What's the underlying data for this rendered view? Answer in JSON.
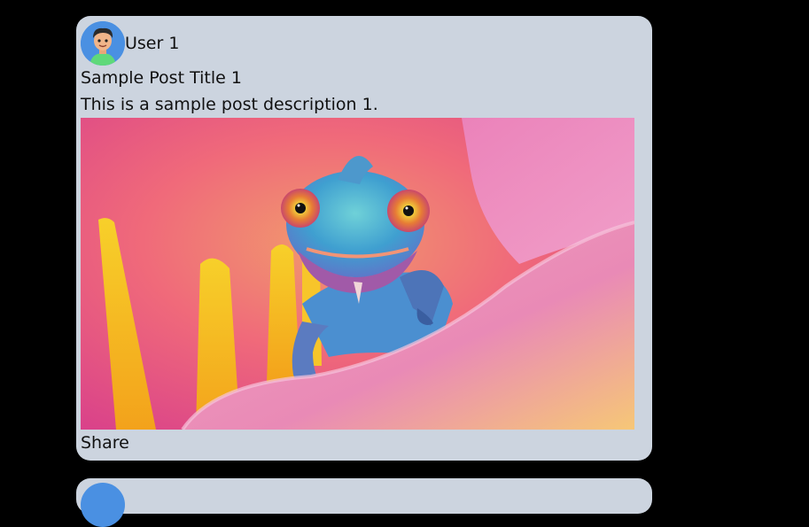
{
  "post": {
    "user_name": "User 1",
    "title": "Sample Post Title 1",
    "description": "This is a sample post description 1.",
    "share_label": "Share",
    "image_subject": "chameleon on pink flower petal"
  },
  "colors": {
    "page_bg": "#000000",
    "card_bg": "#ccd4df",
    "avatar_bg": "#4a90e2"
  }
}
